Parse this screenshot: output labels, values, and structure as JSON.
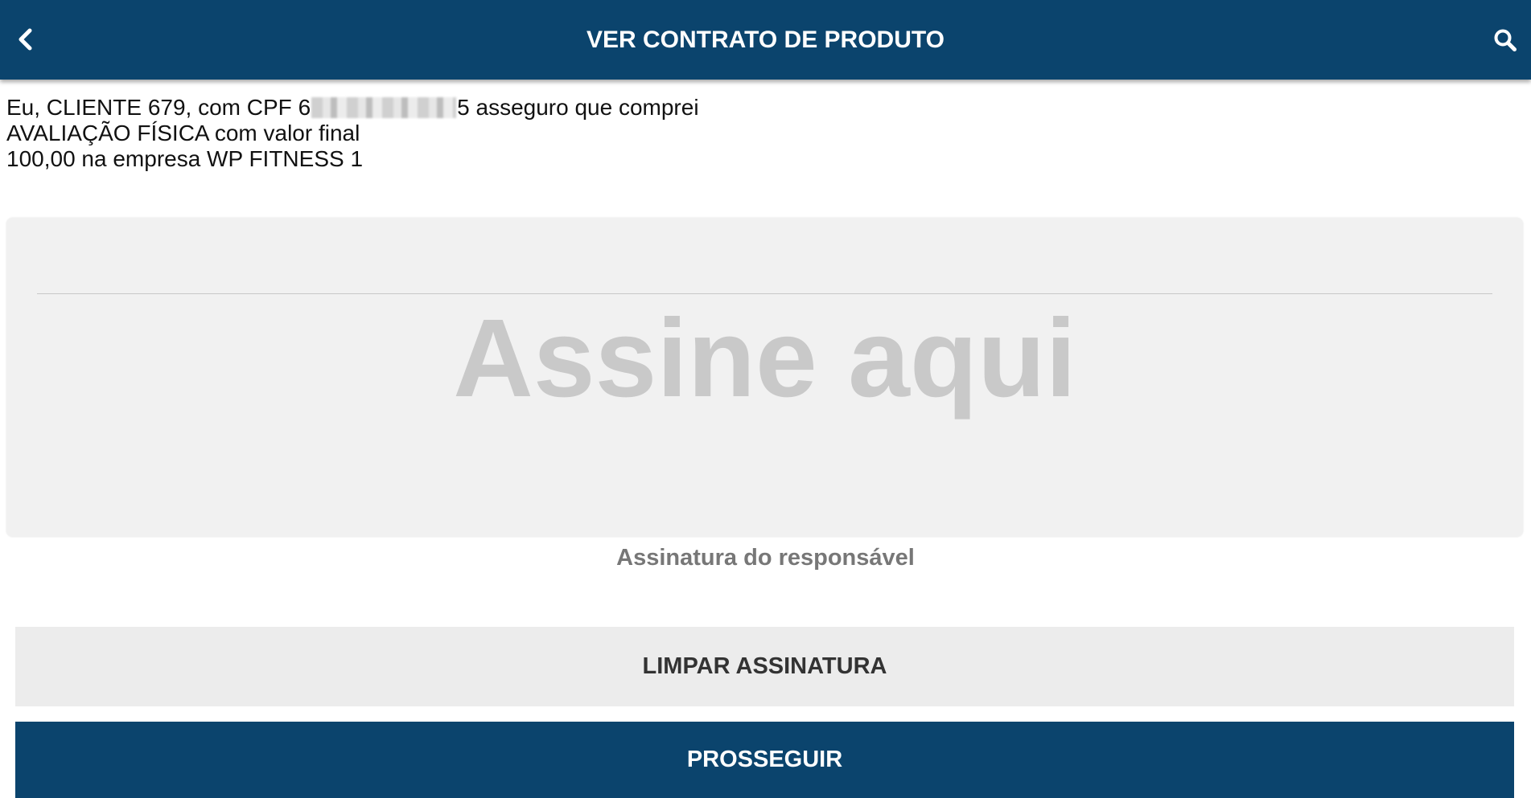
{
  "header": {
    "title": "VER CONTRATO DE PRODUTO",
    "back_icon": "chevron-left-icon",
    "search_icon": "search-icon"
  },
  "contract": {
    "line1_prefix": "Eu, CLIENTE 679, com CPF 6",
    "line1_suffix": "5 asseguro que comprei",
    "line2": "AVALIAÇÃO FÍSICA com valor final",
    "line3": "100,00 na empresa WP FITNESS 1"
  },
  "signature": {
    "placeholder": "Assine aqui",
    "caption": "Assinatura do responsável"
  },
  "buttons": {
    "clear_label": "LIMPAR ASSINATURA",
    "next_label": "PROSSEGUIR"
  },
  "colors": {
    "primary": "#0b446d",
    "pad_background": "#f1f1f1",
    "secondary_button": "#ececec"
  }
}
